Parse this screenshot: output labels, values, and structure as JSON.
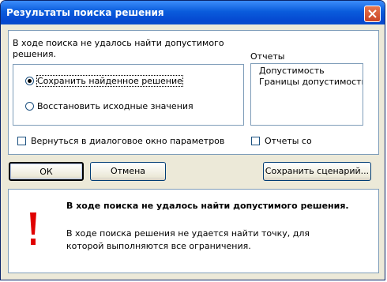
{
  "dialog": {
    "title": "Результаты поиска решения",
    "message": "В ходе поиска не удалось найти допустимого решения.",
    "options": {
      "keep": "Сохранить найденное решение",
      "restore": "Восстановить исходные значения",
      "selected": "keep"
    },
    "reports": {
      "label": "Отчеты",
      "items": [
        "Допустимость",
        "Границы допустимости"
      ]
    },
    "return_checkbox": "Вернуться в диалоговое окно параметров",
    "outline_checkbox": "Отчеты со",
    "buttons": {
      "ok": "ОК",
      "cancel": "Отмена",
      "save_scenario": "Сохранить сценарий..."
    },
    "info": {
      "title": "В ходе поиска не удалось найти допустимого решения.",
      "text": "В ходе поиска решения не удается найти точку, для которой выполняются все ограничения."
    }
  }
}
